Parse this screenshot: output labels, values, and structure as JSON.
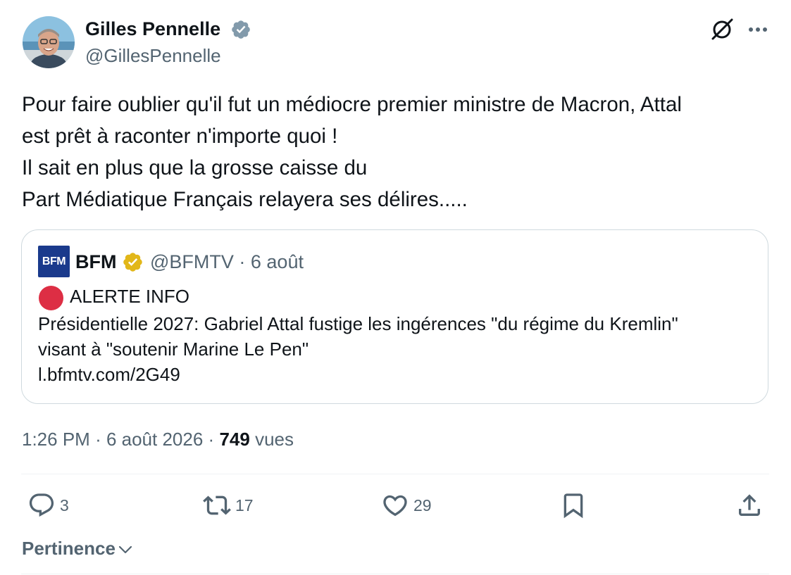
{
  "tweet": {
    "author_name": "Gilles Pennelle",
    "author_handle": "@GillesPennelle",
    "avatar_icon": "user-photo",
    "body_lines": [
      "Pour faire oublier qu'il fut un médiocre premier ministre de Macron, Attal",
      "est prêt à raconter n'importe quoi !",
      "Il sait en plus que la grosse caisse du",
      "Part Médiatique Français relayera ses délires....."
    ],
    "time": "1:26 PM",
    "date": "6 août 2026",
    "views_count": "749",
    "views_label": "vues"
  },
  "quote": {
    "logo_text": "BFM",
    "name": "BFM",
    "handle_date": "@BFMTV · 6 août",
    "alert": "ALERTE INFO",
    "lines": [
      "Présidentielle 2027: Gabriel Attal fustige les ingérences \"du régime du Kremlin\"",
      "visant à \"soutenir Marine Le Pen\"",
      "l.bfmtv.com/2G49"
    ]
  },
  "actions": {
    "replies": "3",
    "reposts": "17",
    "likes": "29"
  },
  "sort": {
    "label": "Pertinence"
  },
  "colors": {
    "text": "#0f1419",
    "secondary": "#536471",
    "verified_blue": "#829aab",
    "verified_gold": "#e2b719",
    "alert_red": "#dd2e44",
    "border": "#cfd9de"
  }
}
